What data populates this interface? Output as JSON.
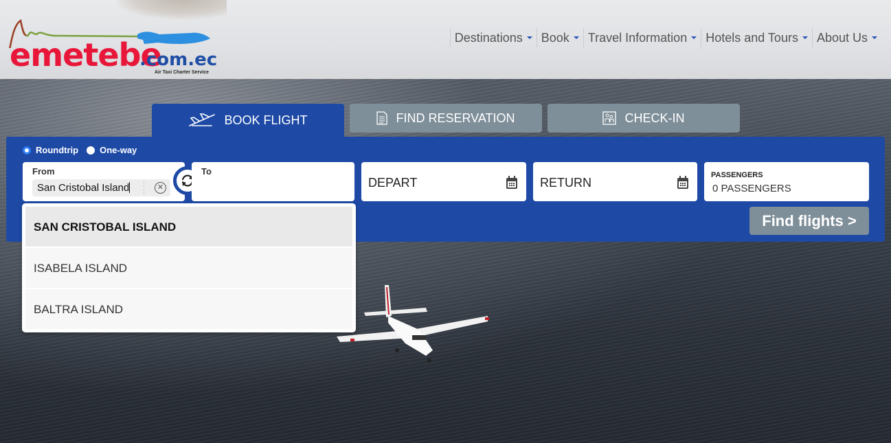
{
  "brand": {
    "name": "emetebe",
    "domain": ".com.ec",
    "tagline": "Air Taxi Charter Service",
    "colors": {
      "red": "#e8173a",
      "blue": "#1f4ea5"
    }
  },
  "nav": {
    "items": [
      {
        "label": "Destinations",
        "icon": "caret-down-icon"
      },
      {
        "label": "Book",
        "icon": "caret-down-icon"
      },
      {
        "label": "Travel Information",
        "icon": "caret-down-icon"
      },
      {
        "label": "Hotels and Tours",
        "icon": "caret-down-icon"
      },
      {
        "label": "About Us",
        "icon": "caret-down-icon"
      }
    ]
  },
  "tabs": [
    {
      "label": "BOOK FLIGHT",
      "icon": "airplane-icon",
      "active": true
    },
    {
      "label": "FIND RESERVATION",
      "icon": "document-icon",
      "active": false
    },
    {
      "label": "CHECK-IN",
      "icon": "passengers-icon",
      "active": false
    }
  ],
  "booking": {
    "trip_types": [
      {
        "label": "Roundtrip",
        "checked": true
      },
      {
        "label": "One-way",
        "checked": false
      }
    ],
    "from": {
      "label": "From",
      "value": "San Cristobal Island"
    },
    "to": {
      "label": "To",
      "value": ""
    },
    "depart": {
      "placeholder": "DEPART"
    },
    "return": {
      "placeholder": "RETURN"
    },
    "passengers": {
      "label": "PASSENGERS",
      "value": "0 PASSENGERS"
    },
    "submit_label": "Find flights >",
    "accent_color": "#1e4aa6",
    "button_color": "#7f8f99"
  },
  "dropdown": {
    "options": [
      {
        "label": "SAN CRISTOBAL ISLAND",
        "highlighted": true
      },
      {
        "label": "ISABELA ISLAND",
        "highlighted": false
      },
      {
        "label": "BALTRA ISLAND",
        "highlighted": false
      }
    ]
  }
}
